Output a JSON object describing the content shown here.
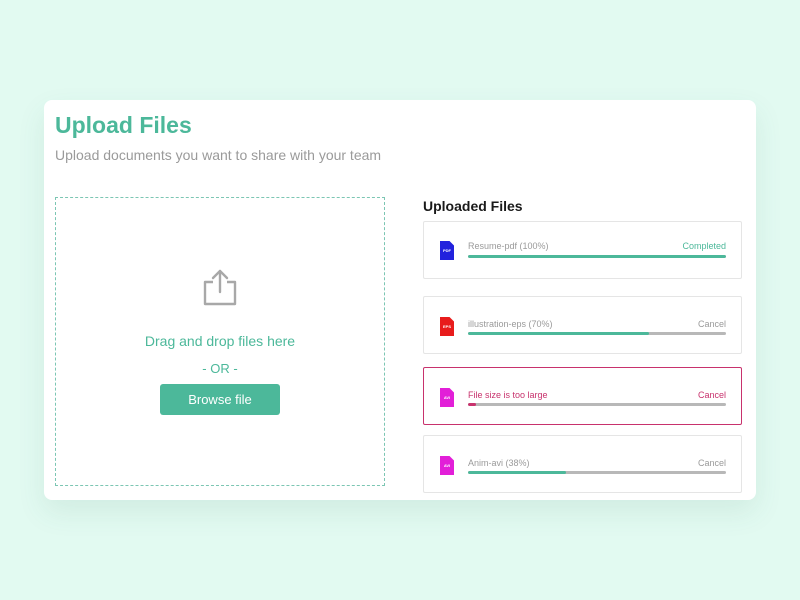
{
  "header": {
    "title": "Upload Files",
    "subtitle": "Upload documents you want to share with your team"
  },
  "dropzone": {
    "icon": "share-upload-icon",
    "drag_text": "Drag and drop files here",
    "or_text": "- OR -",
    "browse_label": "Browse file"
  },
  "uploaded": {
    "heading": "Uploaded Files",
    "files": [
      {
        "type": "PDF",
        "name": "Resume-pdf (100%)",
        "status": "Completed",
        "progress": 100,
        "icon_color": "#2222dd",
        "state": "completed"
      },
      {
        "type": "EPS",
        "name": "illustration-eps (70%)",
        "status": "Cancel",
        "progress": 70,
        "icon_color": "#e81c1c",
        "state": "uploading"
      },
      {
        "type": "AVI",
        "name": "File size is too large",
        "status": "Cancel",
        "progress": 3,
        "icon_color": "#e21fd8",
        "state": "error"
      },
      {
        "type": "AVI",
        "name": "Anim-avi (38%)",
        "status": "Cancel",
        "progress": 38,
        "icon_color": "#e21fd8",
        "state": "uploading"
      }
    ]
  },
  "colors": {
    "accent": "#4cb89a",
    "error": "#c8326d",
    "background": "#e2faf1"
  }
}
